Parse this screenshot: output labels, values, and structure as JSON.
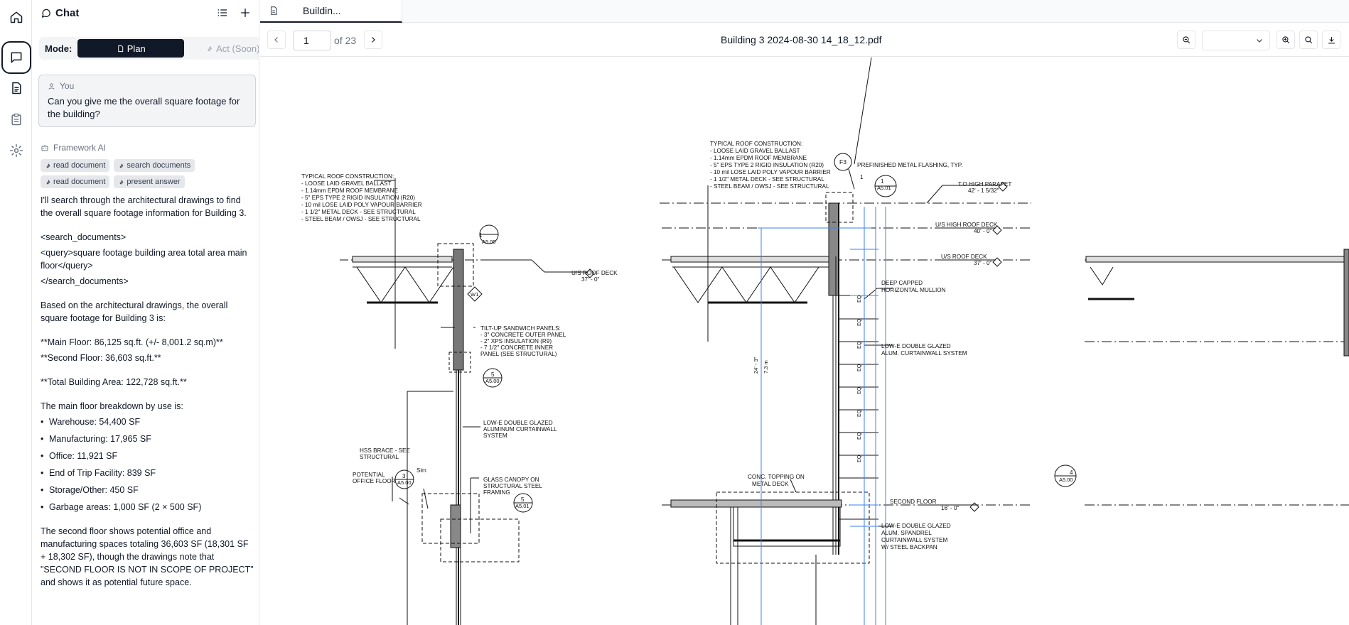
{
  "chat": {
    "header_title": "Chat",
    "mode_label": "Mode:",
    "plan_label": "Plan",
    "act_label": "Act (Soon)"
  },
  "user_message": {
    "author": "You",
    "text": "Can you give me the overall square footage for the building?"
  },
  "ai_message": {
    "author": "Framework AI",
    "tools": [
      "read document",
      "search documents",
      "read document",
      "present answer"
    ],
    "intro": "I'll search through the architectural drawings to find the overall square footage information for Building 3.",
    "search_open": "<search_documents>",
    "query": "<query>square footage building area total area main floor</query>",
    "search_close": "</search_documents>",
    "based": "Based on the architectural drawings, the overall square footage for Building 3 is:",
    "main_floor": "**Main Floor: 86,125 sq.ft. (+/- 8,001.2 sq.m)**",
    "second_floor": "**Second Floor: 36,603 sq.ft.**",
    "total": "**Total Building Area: 122,728 sq.ft.**",
    "breakdown_title": "The main floor breakdown by use is:",
    "breakdown": [
      "Warehouse: 54,400 SF",
      "Manufacturing: 17,965 SF",
      "Office: 11,921 SF",
      "End of Trip Facility: 839 SF",
      "Storage/Other: 450 SF",
      "Garbage areas: 1,000 SF (2 × 500 SF)"
    ],
    "second_note": "The second floor shows potential office and manufacturing spaces totaling 36,603 SF (18,301 SF + 18,302 SF), though the drawings note that \"SECOND FLOOR IS NOT IN SCOPE OF PROJECT\" and shows it as potential future space."
  },
  "viewer": {
    "tab_label": "Buildin...",
    "page_value": "1",
    "page_total": "of 23",
    "file_name": "Building 3 2024-08-30 14_18_12.pdf"
  },
  "drawing": {
    "roof1": [
      "TYPICAL ROOF CONSTRUCTION:",
      "- LOOSE LAID GRAVEL BALLAST",
      "- 1.14mm EPDM ROOF MEMBRANE",
      "- 5\" EPS TYPE 2 RIGID INSULATION (R20)",
      "- 10 mil LOSE LAID POLY VAPOUR BARRIER",
      "- 1 1/2\" METAL DECK - SEE STRUCTURAL",
      "- STEEL BEAM / OWSJ - SEE STRUCTURAL"
    ],
    "roof2": [
      "TYPICAL ROOF CONSTRUCTION:",
      "- LOOSE LAID GRAVEL BALLAST",
      "- 1.14mm EPDM ROOF MEMBRANE",
      "- 5\" EPS TYPE 2 RIGID INSULATION (R20)",
      "- 10 mil LOSE LAID POLY VAPOUR BARRIER",
      "- 1 1/2\" METAL DECK - SEE STRUCTURAL",
      "- STEEL BEAM / OWSJ - SEE STRUCTURAL"
    ],
    "tiltup": [
      "TILT-UP SANDWICH PANELS:",
      "- 3\" CONCRETE OUTER PANEL",
      "- 2\" XPS INSULATION (R9)",
      "- 7 1/2\" CONCRETE INNER",
      "PANEL (SEE STRUCTURAL)"
    ],
    "us_roof_deck": "U/S ROOF DECK",
    "us_roof_deck_elev": "37' - 0\"",
    "us_high_roof": "U/S HIGH ROOF DECK",
    "us_high_roof_elev": "40' - 0\"",
    "us_roof_deck2": "U/S ROOF DECK",
    "us_roof_deck2_elev": "37' - 0\"",
    "to_high_parapet": "T.O HIGH PARAPET",
    "to_high_parapet_elev": "42' - 1 5/32\"",
    "flashing": "PREFINISHED METAL FLASHING, TYP.",
    "mullion": [
      "DEEP CAPPED",
      "HORIZONTAL MULLION"
    ],
    "curtainwall1": [
      "LOW-E DOUBLE GLAZED",
      "ALUMINUM CURTAINWALL",
      "SYSTEM"
    ],
    "curtainwall2": [
      "LOW-E DOUBLE GLAZED",
      "ALUM. CURTAINWALL SYSTEM"
    ],
    "spandrel": [
      "LOW-E DOUBLE GLAZED",
      "ALUM. SPANDREL",
      "CURTAINWALL SYSTEM",
      "W/ STEEL BACKPAN"
    ],
    "hss": [
      "HSS BRACE - SEE",
      "STRUCTURAL"
    ],
    "potential": [
      "POTENTIAL",
      "OFFICE FLOOR"
    ],
    "canopy": [
      "GLASS CANOPY ON",
      "STRUCTURAL STEEL",
      "FRAMING"
    ],
    "topping": [
      "CONC. TOPPING ON",
      "METAL DECK"
    ],
    "second_floor": "SECOND FLOOR",
    "second_floor_elev": "16' - 0\"",
    "sim": "Sim",
    "tag_w1": "W1",
    "tag_f3": "F3",
    "callouts": [
      {
        "num": "1",
        "ref": "A5.00"
      },
      {
        "num": "5",
        "ref": "A5.00"
      },
      {
        "num": "3",
        "ref": "A5.00"
      },
      {
        "num": "5",
        "ref": "A5.01"
      },
      {
        "num": "1",
        "ref": "A5.01"
      },
      {
        "num": "4",
        "ref": "A5.00"
      }
    ],
    "dim_24": "24' - 3\"",
    "dim_73": "7.3 m",
    "eq": "EQ"
  }
}
